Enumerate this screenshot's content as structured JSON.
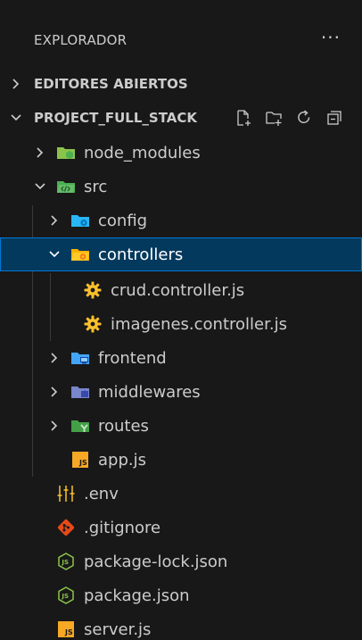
{
  "explorer": {
    "title": "EXPLORADOR",
    "more_label": "···"
  },
  "sections": {
    "open_editors": {
      "label": "EDITORES ABIERTOS"
    },
    "project": {
      "label": "PROJECT_FULL_STACK"
    }
  },
  "tree": [
    {
      "label": "node_modules",
      "icon": "folder-node-icon",
      "chevron": "right"
    },
    {
      "label": "src",
      "icon": "folder-src-icon",
      "chevron": "down"
    },
    {
      "label": "config",
      "icon": "folder-config-icon",
      "chevron": "right"
    },
    {
      "label": "controllers",
      "icon": "folder-controllers-open-icon",
      "chevron": "down",
      "selected": true
    },
    {
      "label": "crud.controller.js",
      "icon": "gear-file-icon"
    },
    {
      "label": "imagenes.controller.js",
      "icon": "gear-file-icon"
    },
    {
      "label": "frontend",
      "icon": "folder-frontend-icon",
      "chevron": "right"
    },
    {
      "label": "middlewares",
      "icon": "folder-middlewares-icon",
      "chevron": "right"
    },
    {
      "label": "routes",
      "icon": "folder-routes-icon",
      "chevron": "right"
    },
    {
      "label": "app.js",
      "icon": "js-file-icon"
    },
    {
      "label": ".env",
      "icon": "env-file-icon"
    },
    {
      "label": ".gitignore",
      "icon": "git-file-icon"
    },
    {
      "label": "package-lock.json",
      "icon": "npm-json-icon"
    },
    {
      "label": "package.json",
      "icon": "npm-json-icon"
    },
    {
      "label": "server.js",
      "icon": "js-file-icon"
    }
  ],
  "colors": {
    "background": "#181818",
    "selection": "#04395e",
    "selection_border": "#0078d4",
    "text": "#cccccc"
  }
}
